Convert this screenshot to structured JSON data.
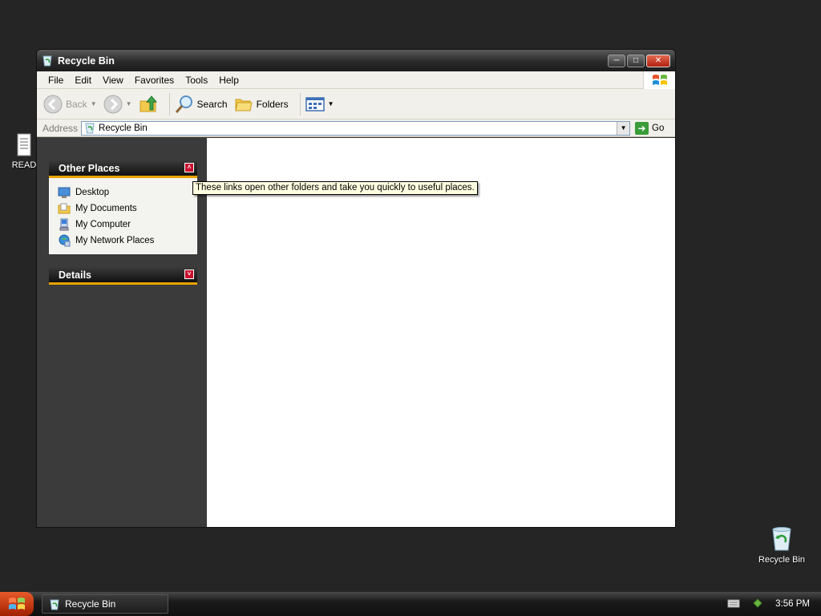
{
  "desktop": {
    "readme_label": "READ",
    "recycle_label": "Recycle Bin"
  },
  "window": {
    "title": "Recycle Bin",
    "menu": [
      "File",
      "Edit",
      "View",
      "Favorites",
      "Tools",
      "Help"
    ],
    "toolbar": {
      "back": "Back",
      "search": "Search",
      "folders": "Folders"
    },
    "address": {
      "label": "Address",
      "value": "Recycle Bin",
      "go": "Go"
    }
  },
  "taskpane": {
    "other_places": {
      "title": "Other Places",
      "links": [
        "Desktop",
        "My Documents",
        "My Computer",
        "My Network Places"
      ]
    },
    "details": {
      "title": "Details"
    }
  },
  "tooltip": "These links open other folders and take you quickly to useful places.",
  "taskbar": {
    "task_label": "Recycle Bin",
    "clock": "3:56 PM"
  }
}
